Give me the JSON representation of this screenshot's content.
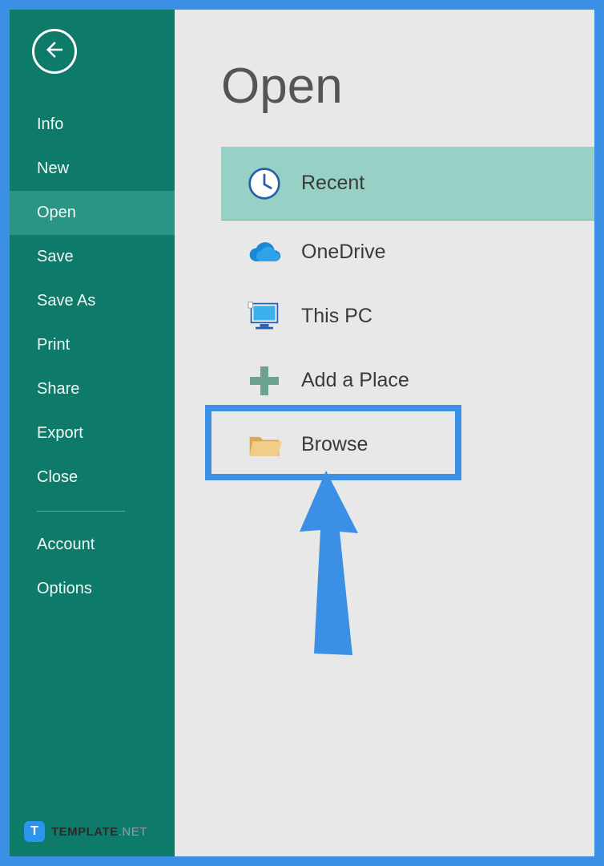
{
  "sidebar": {
    "items": [
      {
        "label": "Info"
      },
      {
        "label": "New"
      },
      {
        "label": "Open",
        "active": true
      },
      {
        "label": "Save"
      },
      {
        "label": "Save As"
      },
      {
        "label": "Print"
      },
      {
        "label": "Share"
      },
      {
        "label": "Export"
      },
      {
        "label": "Close"
      }
    ],
    "bottom_items": [
      {
        "label": "Account"
      },
      {
        "label": "Options"
      }
    ]
  },
  "main": {
    "title": "Open",
    "places": [
      {
        "label": "Recent",
        "selected": true
      },
      {
        "label": "OneDrive"
      },
      {
        "label": "This PC"
      },
      {
        "label": "Add a Place"
      },
      {
        "label": "Browse"
      }
    ]
  },
  "watermark": {
    "badge": "T",
    "name": "TEMPLATE",
    "suffix": ".NET"
  },
  "colors": {
    "frame_border": "#3b8fe4",
    "sidebar_bg": "#0e7a6a",
    "sidebar_active": "#2a9485",
    "place_selected": "#97d0c4"
  }
}
